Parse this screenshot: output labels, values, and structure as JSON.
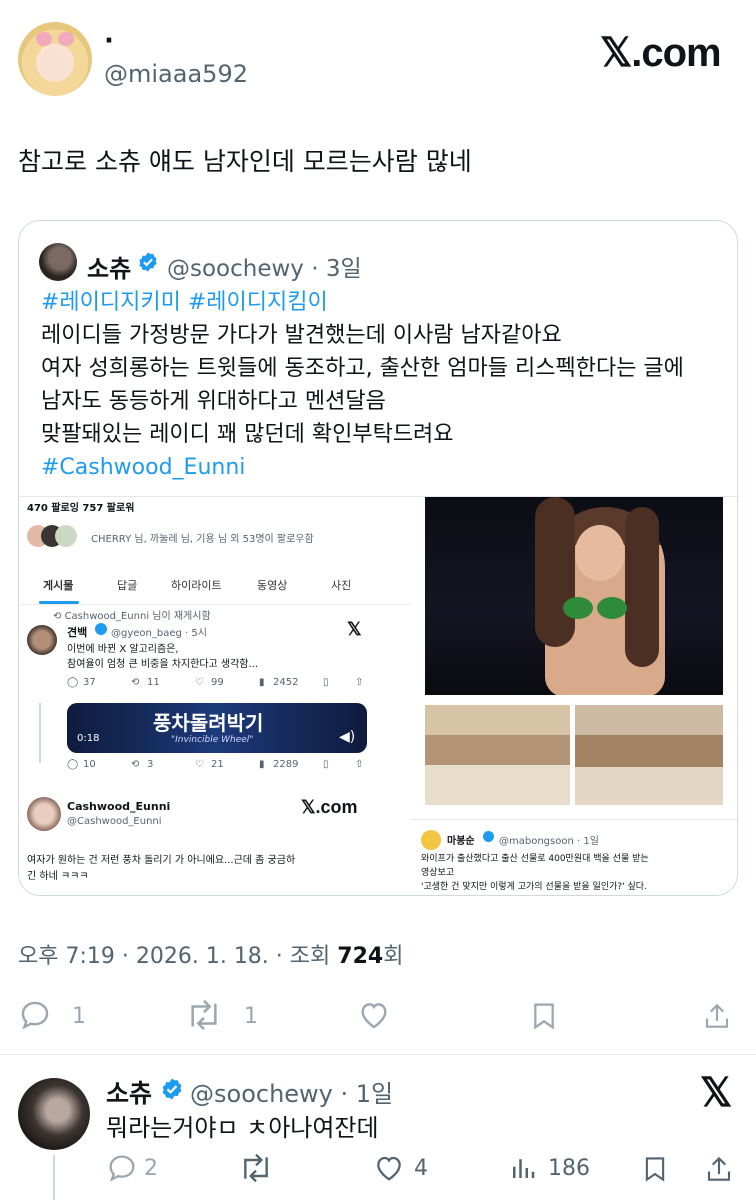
{
  "tweet": {
    "display_name": "·",
    "handle": "@miaaa592",
    "logo_text": "𝕏.com",
    "text": "참고로 소츄 얘도 남자인데 모르는사람 많네",
    "meta": {
      "time": "오후 7:19 · 2026. 1. 18. · 조회 ",
      "views": "724",
      "views_suffix": "회"
    },
    "actions": {
      "replies": "1",
      "retweets": "1"
    }
  },
  "quote": {
    "name": "소츄",
    "handle": "@soochewy · 3일",
    "hashtags": "#레이디지키미 #레이디지킴이",
    "lines": [
      "레이디들 가정방문 가다가 발견했는데 이사람 남자같아요",
      "여자 성희롱하는 트윗들에 동조하고, 출산한 엄마들 리스펙한다는 글에",
      "남자도 동등하게 위대하다고 멘션달음",
      "맞팔돼있는 레이디 꽤 많던데 확인부탁드려요"
    ],
    "hashtag2": "#Cashwood_Eunni"
  },
  "inner": {
    "follow_counts": "470 팔로잉   757 팔로워",
    "followed_by": "CHERRY 님, 까눌레 님, 기용 님 외 53명이 팔로우함",
    "tabs": [
      "게시물",
      "답글",
      "하이라이트",
      "동영상",
      "사진"
    ],
    "retweet_note": "Cashwood_Eunni 님이 재게시함",
    "post1": {
      "name": "견백",
      "handle": "@gyeon_baeg · 5시",
      "text1": "이번에 바뀐 X 알고리즘은,",
      "text2": "참여율이 엄청 큰 비중을 차지한다고 생각함...",
      "stats": [
        "37",
        "11",
        "99",
        "2452"
      ]
    },
    "video": {
      "title": "풍차돌려박기",
      "subtitle": "\"Invincible Wheel\"",
      "time": "0:18"
    },
    "post2_stats": [
      "10",
      "3",
      "21",
      "2289"
    ],
    "cashwood": {
      "name": "Cashwood_Eunni",
      "handle": "@Cashwood_Eunni",
      "logo": "𝕏.com",
      "text1": "여자가 원하는 건 저런 풍차 돌리기 가 아니에요...근데 좀 궁금하",
      "text2": "긴 하네 ㅋㅋㅋ"
    },
    "mabong": {
      "name": "마봉순",
      "handle": "@mabongsoon · 1일",
      "text1": "와이프가 출산했다고 출산 선물로 400만원대 백을 선물 받는",
      "text2": "영상보고",
      "text3": "'고생한 건 맞지만 이렇게 고가의 선물을 받을 일인가?' 싶다."
    }
  },
  "reply": {
    "name": "소츄",
    "handle": "@soochewy · 1일",
    "text": "뭐라는거야ㅁ ㅊ아나여잔데",
    "stats": {
      "replies": "2",
      "likes": "4",
      "views": "186"
    }
  },
  "colors": {
    "accent": "#1d9bf0",
    "muted": "#536471",
    "border": "#cfd9de"
  }
}
